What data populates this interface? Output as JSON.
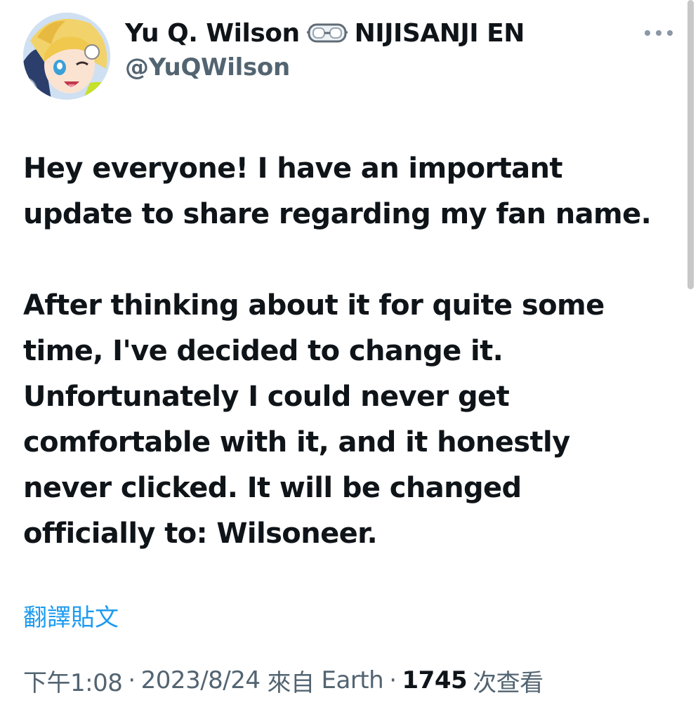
{
  "author": {
    "display_name": "Yu Q. Wilson",
    "badge_icon": "goggles-icon",
    "affiliation": "NIJISANJI EN",
    "handle": "@YuQWilson"
  },
  "tweet": {
    "paragraph_1": "Hey everyone! I have an important\nupdate to share regarding my fan name.",
    "paragraph_2": "After thinking about it for quite some\ntime, I've decided to change it.\nUnfortunately I could never get\ncomfortable with it, and it honestly\nnever clicked. It will be changed\nofficially to: Wilsoneer."
  },
  "translate_label": "翻譯貼文",
  "meta": {
    "time": "下午1:08",
    "separator": "·",
    "date": "2023/8/24",
    "source_prefix": "來自",
    "source": "Earth",
    "views_count": "1745",
    "views_label": "次查看"
  },
  "colors": {
    "text_primary": "#0f1419",
    "text_secondary": "#536471",
    "link": "#1d9bf0"
  }
}
